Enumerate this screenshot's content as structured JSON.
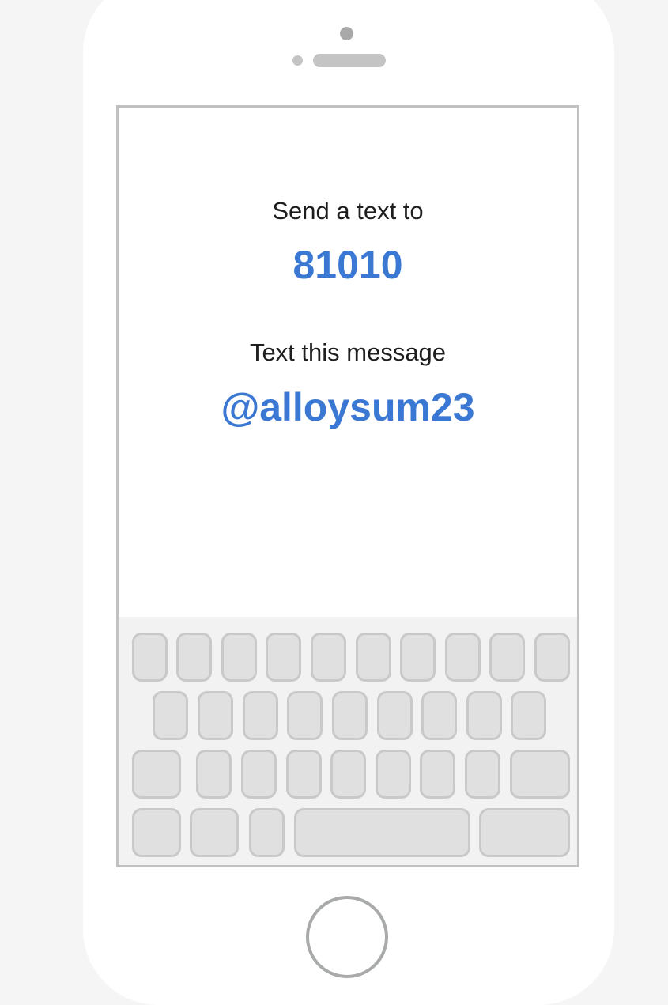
{
  "screen": {
    "send_label": "Send a text to",
    "shortcode": "81010",
    "message_label": "Text this message",
    "keyword": "@alloysum23"
  },
  "colors": {
    "accent": "#3a78d4",
    "text": "#1e1e1e",
    "phone_body": "#ffffff",
    "background": "#f5f5f5",
    "key_fill": "#e0e0e0",
    "key_border": "#c9c9c9"
  },
  "icons": {
    "camera": "camera-icon",
    "home": "home-button-icon"
  }
}
